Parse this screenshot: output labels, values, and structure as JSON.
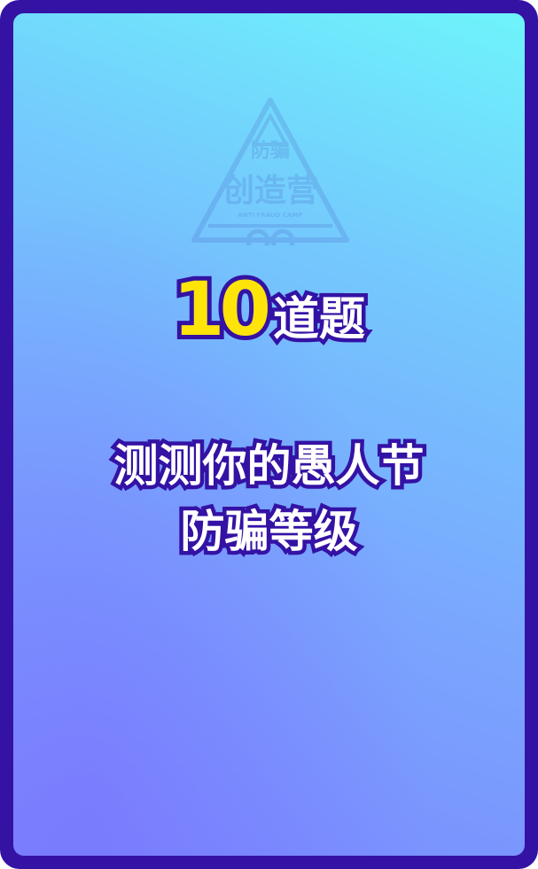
{
  "watermark": {
    "line1": "防骗",
    "line2": "创造营",
    "caption": "ANTI FRAUD CAMP"
  },
  "headline": {
    "number": "10",
    "unit": "道题"
  },
  "subtitle": {
    "line1": "测测你的愚人节",
    "line2": "防骗等级"
  },
  "colors": {
    "frame": "#3412a4",
    "number": "#ffe40a",
    "text": "#ffffff",
    "gradient_top": "#6ef4fb",
    "gradient_bottom": "#7b88fe"
  }
}
